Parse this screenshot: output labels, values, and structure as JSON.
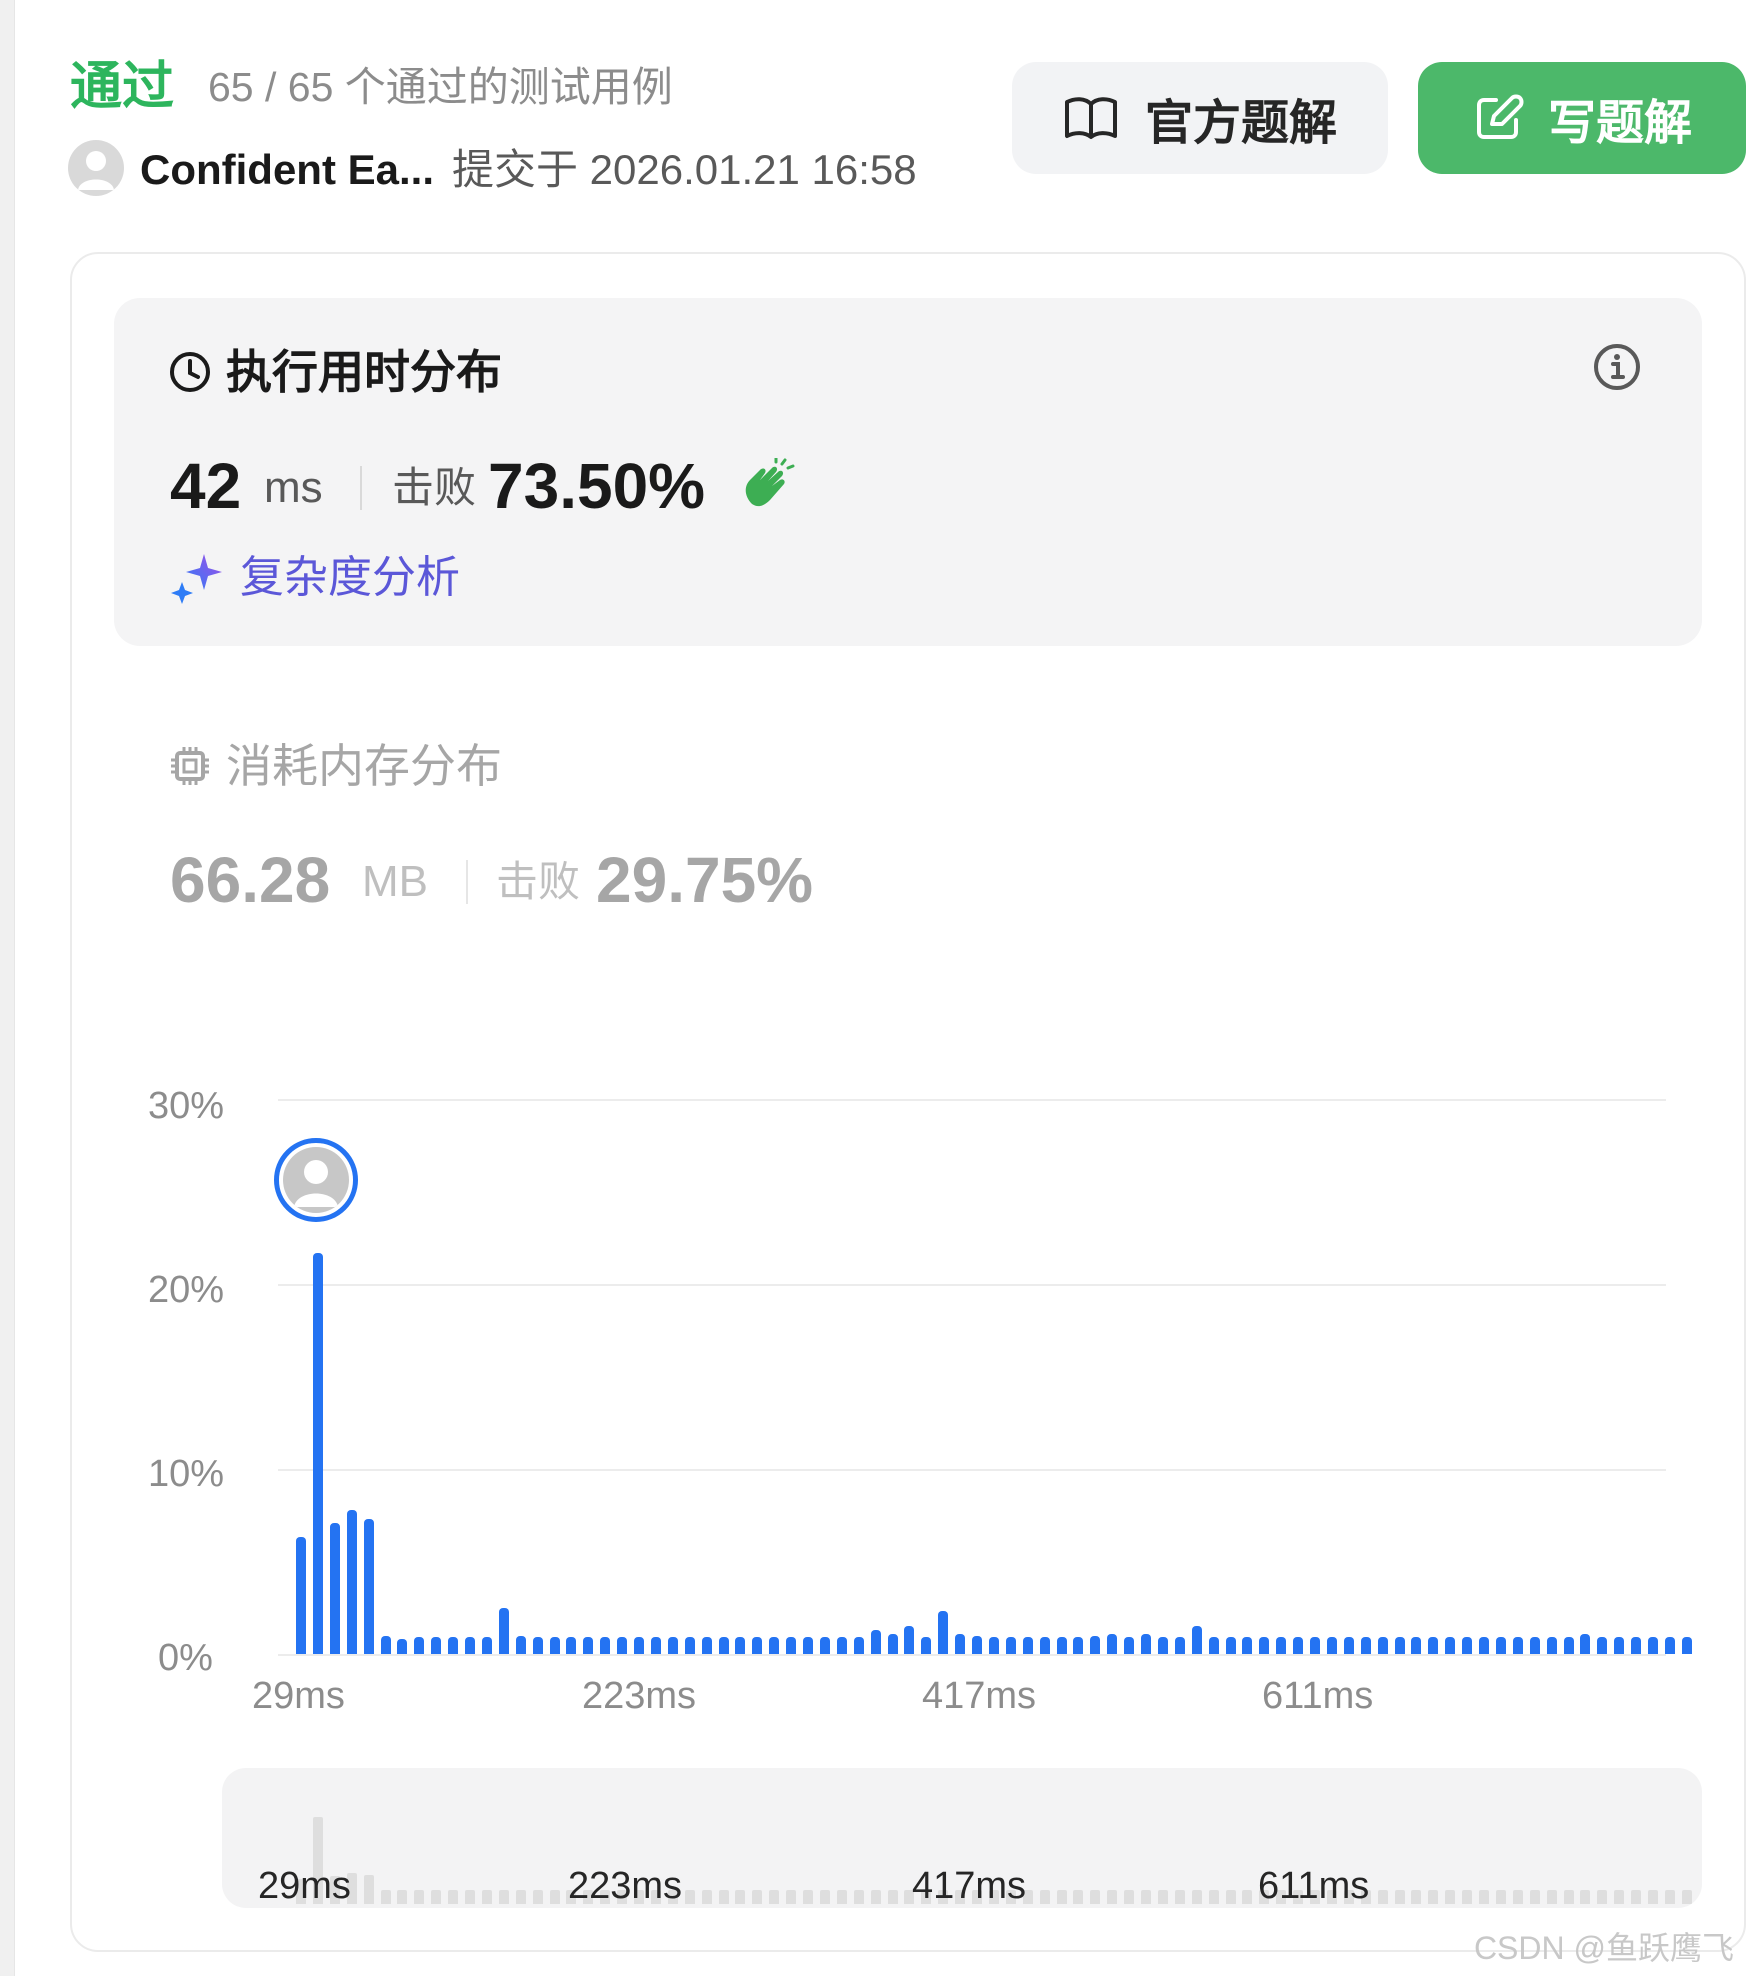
{
  "header": {
    "status": "通过",
    "cases": "65 / 65 个通过的测试用例",
    "author": "Confident Ea...",
    "submitted": "提交于 2026.01.21 16:58",
    "official_solution": "官方题解",
    "write_solution": "写题解"
  },
  "runtime": {
    "title": "执行用时分布",
    "value": "42",
    "unit": "ms",
    "beat_label": "击败",
    "beat_value": "73.50%",
    "complexity_link": "复杂度分析"
  },
  "memory": {
    "title": "消耗内存分布",
    "value": "66.28",
    "unit": "MB",
    "beat_label": "击败",
    "beat_value": "29.75%"
  },
  "minimap": {
    "x_tick_labels": [
      "29ms",
      "223ms",
      "417ms",
      "611ms"
    ]
  },
  "watermark": "CSDN @鱼跃鹰飞",
  "colors": {
    "accent_green": "#2db55d",
    "button_green": "#4cb86a",
    "bar_blue": "#2473f2",
    "link_purple": "#5b57d8"
  },
  "icons": {
    "official_solution": "book-icon",
    "write_solution": "edit-icon",
    "runtime_title": "clock-icon",
    "info": "info-icon",
    "beat": "clap-icon",
    "complexity": "sparkle-icon",
    "memory_title": "chip-icon"
  },
  "chart_data": {
    "type": "bar",
    "title": "",
    "xlabel": "",
    "ylabel": "",
    "ylim": [
      0,
      30
    ],
    "y_tick_labels": [
      "30%",
      "20%",
      "10%",
      "0%"
    ],
    "x_tick_labels": [
      "29ms",
      "223ms",
      "417ms",
      "611ms"
    ],
    "series": [
      {
        "values": [
          6.3,
          21.7,
          7.1,
          7.8,
          7.3,
          1.0,
          0.8,
          0.9,
          0.9,
          0.9,
          0.9,
          0.9,
          2.5,
          1.0,
          0.9,
          0.9,
          0.9,
          0.9,
          0.9,
          0.9,
          0.9,
          0.9,
          0.9,
          0.9,
          0.9,
          0.9,
          0.9,
          0.9,
          0.9,
          0.9,
          0.9,
          0.9,
          0.9,
          0.9,
          1.3,
          1.1,
          1.5,
          0.9,
          2.3,
          1.1,
          1.0,
          0.9,
          0.9,
          0.9,
          0.9,
          0.9,
          0.9,
          1.0,
          1.1,
          0.9,
          1.1,
          0.9,
          0.9,
          1.5,
          0.9,
          0.9,
          0.9,
          0.9,
          0.9,
          0.9,
          0.9,
          0.9,
          0.9,
          0.9,
          0.9,
          0.9,
          0.9,
          0.9,
          0.9,
          0.9,
          0.9,
          0.9,
          0.9,
          0.9,
          0.9,
          0.9,
          1.1,
          0.9,
          0.9,
          0.9,
          0.9,
          0.9,
          0.9
        ],
        "highlight_index": 1
      }
    ],
    "grid": true
  }
}
